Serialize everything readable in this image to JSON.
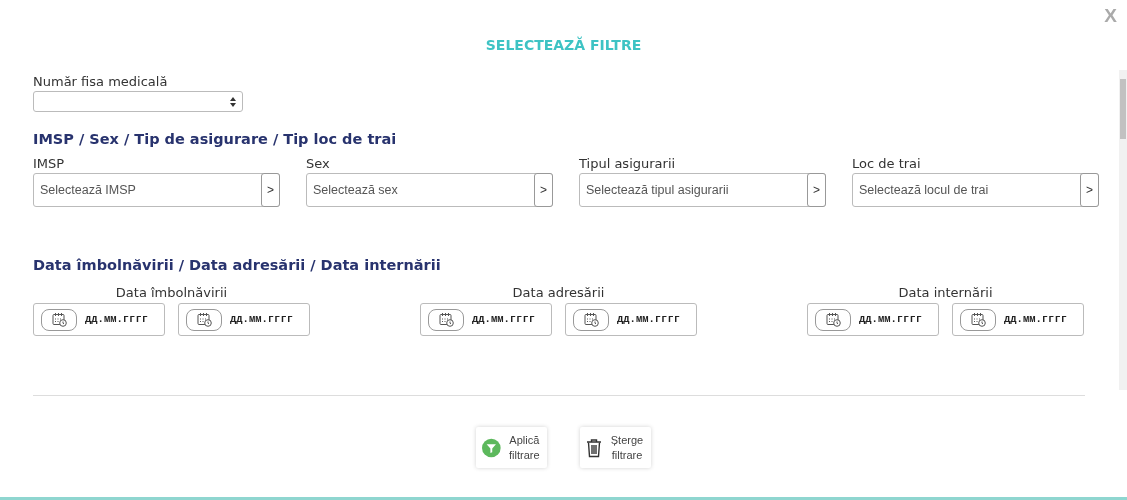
{
  "title": "SELECTEAZĂ FILTRE",
  "close": "X",
  "record_field": {
    "label": "Număr fisa medicală"
  },
  "sections": [
    {
      "kind": "selects",
      "heading": "IMSP / Sex / Tip de asigurare / Tip loc de trai",
      "fields": [
        {
          "label": "IMSP",
          "placeholder": "Selectează IMSP",
          "button": ">"
        },
        {
          "label": "Sex",
          "placeholder": "Selectează sex",
          "button": ">"
        },
        {
          "label": "Tipul asigurarii",
          "placeholder": "Selectează tipul asigurarii",
          "button": ">"
        },
        {
          "label": "Loc de trai",
          "placeholder": "Selectează locul de trai",
          "button": ">"
        }
      ]
    },
    {
      "kind": "dates",
      "heading": "Data îmbolnăvirii / Data adresării / Data internării",
      "groups": [
        {
          "label": "Data îmbolnăvirii",
          "inputs": [
            {
              "placeholder": "дд.мм.гггг"
            },
            {
              "placeholder": "дд.мм.гггг"
            }
          ]
        },
        {
          "label": "Data adresării",
          "inputs": [
            {
              "placeholder": "дд.мм.гггг"
            },
            {
              "placeholder": "дд.мм.гггг"
            }
          ]
        },
        {
          "label": "Data internării",
          "inputs": [
            {
              "placeholder": "дд.мм.гггг"
            },
            {
              "placeholder": "дд.мм.гггг"
            }
          ]
        }
      ]
    }
  ],
  "buttons": [
    {
      "kind": "apply",
      "label": "Aplică filtrare"
    },
    {
      "kind": "clear",
      "label": "Șterge filtrare"
    }
  ]
}
